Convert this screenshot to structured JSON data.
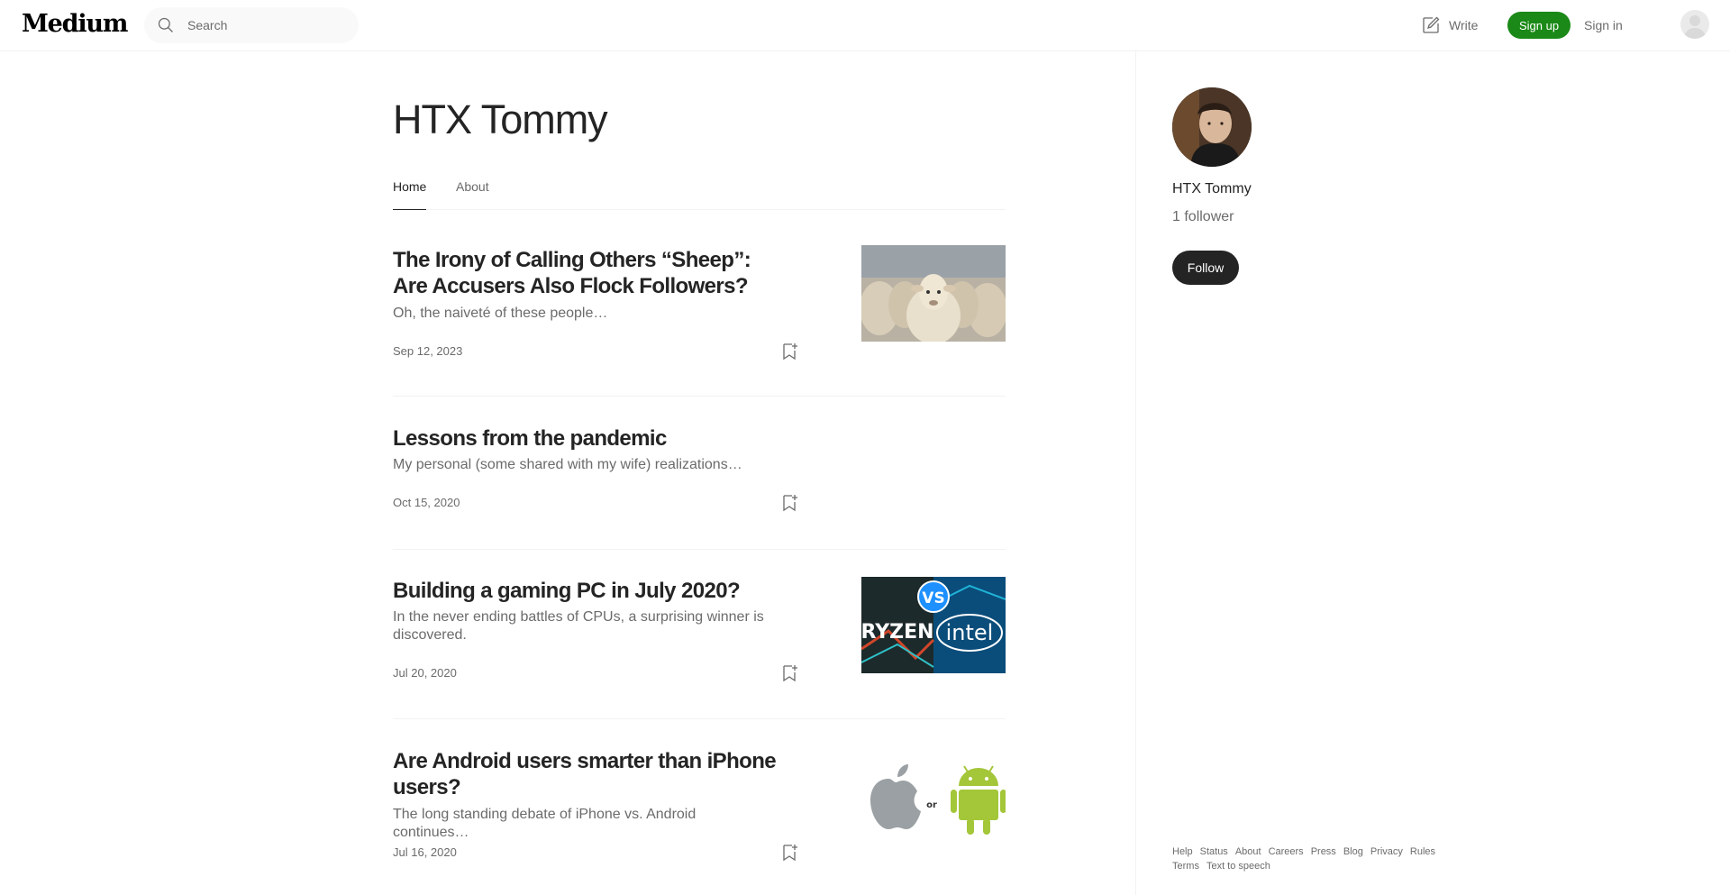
{
  "header": {
    "logo": "Medium",
    "search_placeholder": "Search",
    "write_label": "Write",
    "signup_label": "Sign up",
    "signin_label": "Sign in"
  },
  "publication": {
    "title": "HTX Tommy",
    "tabs": [
      {
        "label": "Home",
        "active": true
      },
      {
        "label": "About",
        "active": false
      }
    ]
  },
  "posts": [
    {
      "title": "The Irony of Calling Others “Sheep”: Are Accusers Also Flock Followers?",
      "subtitle": "Oh, the naiveté of these people…",
      "date": "Sep 12, 2023",
      "thumbnail": "sheep-photo"
    },
    {
      "title": "Lessons from the pandemic",
      "subtitle": "My personal (some shared with my wife) realizations…",
      "date": "Oct 15, 2020",
      "thumbnail": null
    },
    {
      "title": "Building a gaming PC in July 2020?",
      "subtitle": "In the never ending battles of CPUs, a surprising winner is discovered.",
      "date": "Jul 20, 2020",
      "thumbnail": "ryzen-vs-intel",
      "thumbnail_text": {
        "vs": "VS",
        "left": "RYZEN",
        "right": "intel"
      }
    },
    {
      "title": "Are Android users smarter than iPhone users?",
      "subtitle": "The long standing debate of iPhone vs. Android continues…",
      "date": "Jul 16, 2020",
      "thumbnail": "apple-or-android",
      "thumbnail_text": {
        "or": "or"
      }
    }
  ],
  "sidebar": {
    "name": "HTX Tommy",
    "followers": "1 follower",
    "follow_label": "Follow",
    "footer_links": [
      "Help",
      "Status",
      "About",
      "Careers",
      "Press",
      "Blog",
      "Privacy",
      "Rules",
      "Terms",
      "Text to speech"
    ]
  },
  "colors": {
    "accent_green": "#1a8917",
    "text_primary": "#242424",
    "text_secondary": "#6b6b6b",
    "divider": "#f2f2f2"
  }
}
